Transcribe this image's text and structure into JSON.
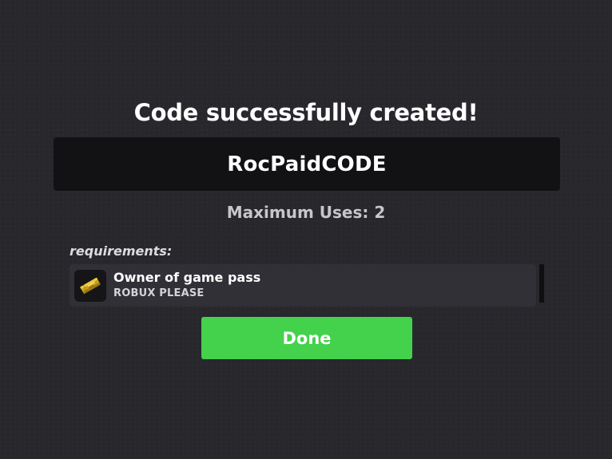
{
  "modal": {
    "title": "Code successfully created!",
    "code": "RocPaidCODE",
    "max_uses": "Maximum Uses: 2",
    "requirements_label": "requirements:",
    "requirements": [
      {
        "icon": "golden-ticket-icon",
        "name": "Owner of game pass",
        "description": "ROBUX PLEASE"
      }
    ],
    "done_label": "Done"
  },
  "colors": {
    "background": "#27272c",
    "code_box": "#121215",
    "requirement_row": "#303036",
    "done_button": "#44d14c",
    "subtitle_text": "#c6c6cb"
  }
}
